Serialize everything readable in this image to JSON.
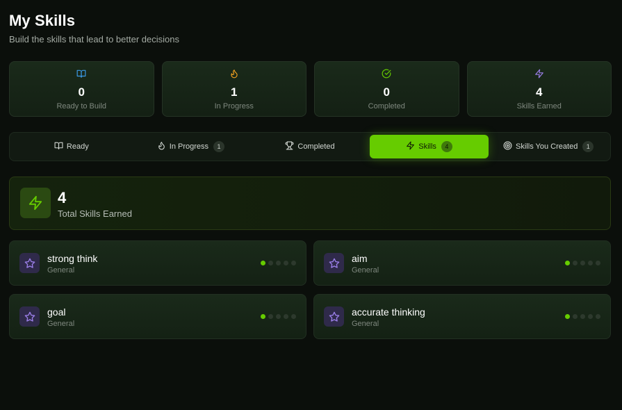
{
  "header": {
    "title": "My Skills",
    "subtitle": "Build the skills that lead to better decisions"
  },
  "stats": [
    {
      "icon": "book-open-icon",
      "value": "0",
      "label": "Ready to Build",
      "color": "#3b9ae8"
    },
    {
      "icon": "flame-icon",
      "value": "1",
      "label": "In Progress",
      "color": "#f0a020"
    },
    {
      "icon": "check-circle-icon",
      "value": "0",
      "label": "Completed",
      "color": "#66cc00"
    },
    {
      "icon": "zap-icon",
      "value": "4",
      "label": "Skills Earned",
      "color": "#9b7fe8"
    }
  ],
  "tabs": [
    {
      "icon": "book-open-icon",
      "label": "Ready",
      "badge": ""
    },
    {
      "icon": "flame-icon",
      "label": "In Progress",
      "badge": "1"
    },
    {
      "icon": "trophy-icon",
      "label": "Completed",
      "badge": ""
    },
    {
      "icon": "zap-icon",
      "label": "Skills",
      "badge": "4",
      "active": true
    },
    {
      "icon": "target-icon",
      "label": "Skills You Created",
      "badge": "1"
    }
  ],
  "summary": {
    "value": "4",
    "label": "Total Skills Earned",
    "accent": "#66cc00"
  },
  "skills": [
    {
      "name": "strong think",
      "category": "General",
      "level": 1,
      "max_level": 5
    },
    {
      "name": "aim",
      "category": "General",
      "level": 1,
      "max_level": 5
    },
    {
      "name": "goal",
      "category": "General",
      "level": 1,
      "max_level": 5
    },
    {
      "name": "accurate thinking",
      "category": "General",
      "level": 1,
      "max_level": 5
    }
  ],
  "colors": {
    "accent": "#66cc00",
    "skill_icon": "#9b7fe8"
  }
}
